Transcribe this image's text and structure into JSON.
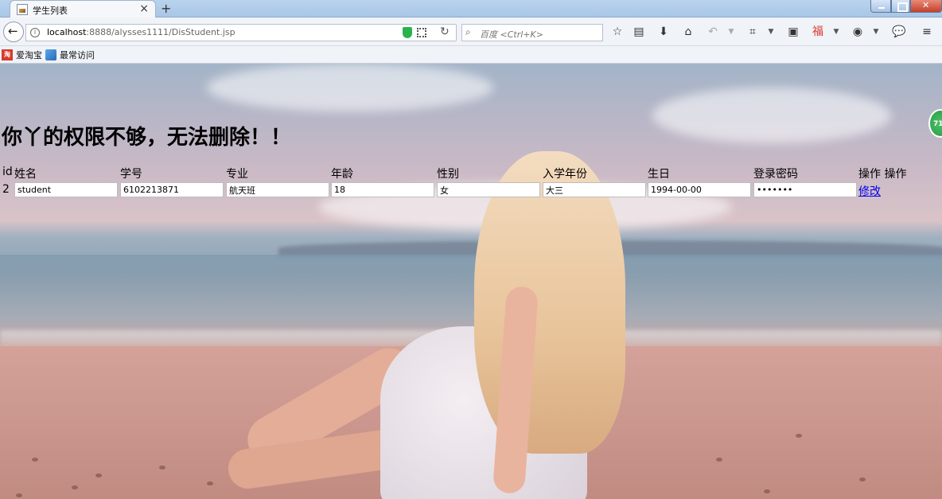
{
  "browser": {
    "tab_title": "学生列表",
    "tab_close": "×",
    "new_tab": "+",
    "url_host": "localhost",
    "url_rest": ":8888/alysses1111/DisStudent.jsp",
    "search_placeholder": "百度 <Ctrl+K>",
    "bookmarks": [
      "爱淘宝",
      "最常访问"
    ],
    "side_badge": "71"
  },
  "page": {
    "message": "你丫的权限不够，无法删除！！",
    "headers": [
      "id",
      "姓名",
      "学号",
      "专业",
      "年龄",
      "性别",
      "入学年份",
      "生日",
      "登录密码",
      "操作 操作"
    ],
    "rows": [
      {
        "id": "2",
        "name": "student",
        "student_no": "6102213871",
        "major": "航天班",
        "age": "18",
        "gender": "女",
        "year": "大三",
        "birthday": "1994-00-00",
        "password": "1234567",
        "action": "修改"
      }
    ]
  }
}
